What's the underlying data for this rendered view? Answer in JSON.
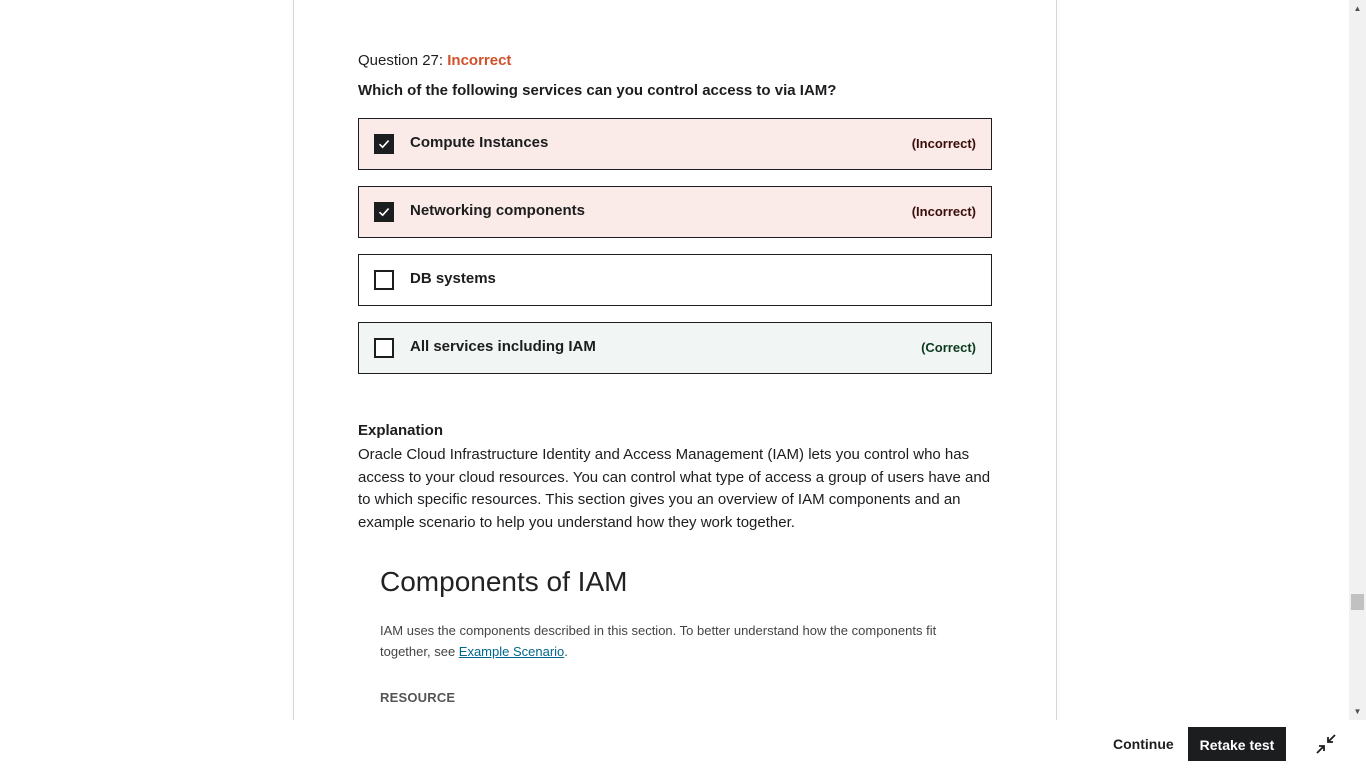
{
  "question": {
    "number_label": "Question 27:",
    "status": "Incorrect",
    "text": "Which of the following services can you control access to via IAM?"
  },
  "options": [
    {
      "label": "Compute Instances",
      "checked": true,
      "result": "(Incorrect)"
    },
    {
      "label": "Networking components",
      "checked": true,
      "result": "(Incorrect)"
    },
    {
      "label": "DB systems",
      "checked": false,
      "result": ""
    },
    {
      "label": "All services including IAM",
      "checked": false,
      "result": "(Correct)"
    }
  ],
  "explanation": {
    "title": "Explanation",
    "body": "Oracle Cloud Infrastructure Identity and Access Management (IAM) lets you control who has access to your cloud resources. You can control what type of access a group of users have and to which specific resources. This section gives you an overview of IAM components and an example scenario to help you understand how they work together."
  },
  "embedded": {
    "title": "Components of IAM",
    "text_before": "IAM uses the components described in this section. To better understand how the components fit together, see ",
    "link": "Example Scenario",
    "text_after": ".",
    "subheading": "RESOURCE"
  },
  "footer": {
    "continue_label": "Continue",
    "retake_label": "Retake test"
  },
  "icons": {
    "checkbox_checked": "checkmark-icon",
    "collapse": "collapse-icon"
  },
  "colors": {
    "incorrect": "#d1512a",
    "incorrect_bg": "#fbebe8",
    "correct_bg": "#f1f5f3",
    "button_dark": "#1c1d1f",
    "link": "#00688c"
  }
}
